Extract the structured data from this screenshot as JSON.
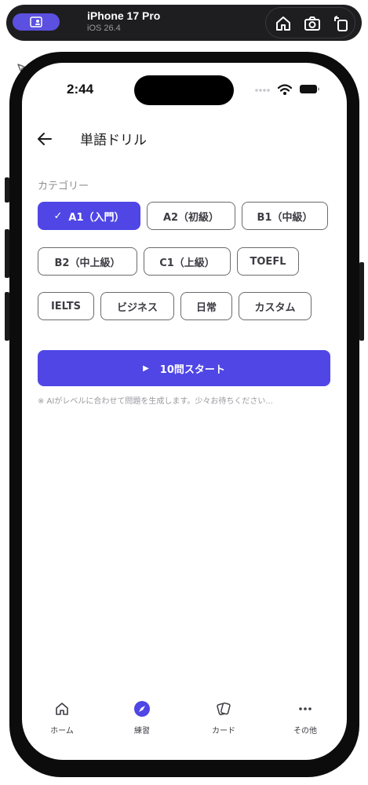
{
  "simulator": {
    "device_name": "iPhone 17 Pro",
    "os_version": "iOS 26.4"
  },
  "status_bar": {
    "time": "2:44"
  },
  "header": {
    "title": "単語ドリル"
  },
  "category": {
    "label": "カテゴリー",
    "selected": "A1（入門）",
    "chips": [
      "A1（入門）",
      "A2（初級）",
      "B1（中級）",
      "B2（中上級）",
      "C1（上級）",
      "TOEFL",
      "IELTS",
      "ビジネス",
      "日常",
      "カスタム"
    ]
  },
  "start_button": {
    "label": "10問スタート",
    "icon": "play-icon"
  },
  "note": "※ AIがレベルに合わせて問題を生成します。少々お待ちください...",
  "tabbar": {
    "items": [
      {
        "label": "ホーム",
        "icon": "home-icon"
      },
      {
        "label": "練習",
        "icon": "compass-icon"
      },
      {
        "label": "カード",
        "icon": "cards-icon"
      },
      {
        "label": "その他",
        "icon": "more-icon"
      }
    ],
    "active": "練習"
  },
  "colors": {
    "accent": "#4f46e5",
    "simulator_button": "#5b50e0"
  }
}
